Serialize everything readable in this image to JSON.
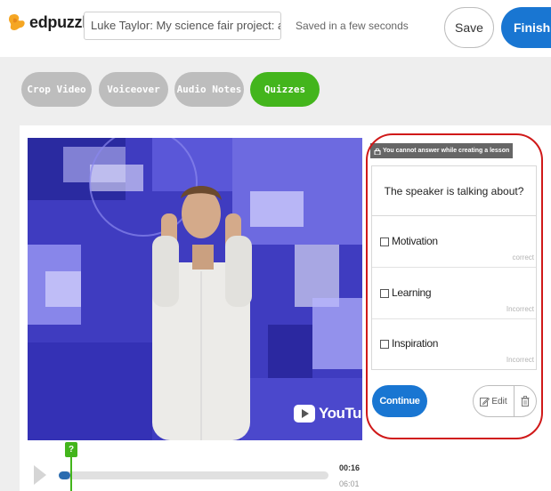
{
  "brand": {
    "name": "edpuzzle"
  },
  "header": {
    "title_value": "Luke Taylor: My science fair project: a robot that…",
    "saved_status": "Saved in a few seconds",
    "save_label": "Save",
    "finish_label": "Finish"
  },
  "tabs": [
    {
      "label": "Crop Video",
      "active": false
    },
    {
      "label": "Voiceover",
      "active": false
    },
    {
      "label": "Audio Notes",
      "active": false
    },
    {
      "label": "Quizzes",
      "active": true
    }
  ],
  "video": {
    "provider_logo": "YouTube"
  },
  "player": {
    "current_time": "00:16",
    "total_time": "06:01",
    "marker_label": "?",
    "progress_fraction": 0.044
  },
  "quiz": {
    "locked_notice": "You cannot answer while creating a lesson",
    "question": "The speaker is talking about?",
    "answers": [
      {
        "label": "Motivation",
        "status": "correct"
      },
      {
        "label": "Learning",
        "status": "Incorrect"
      },
      {
        "label": "Inspiration",
        "status": "Incorrect"
      }
    ],
    "continue_label": "Continue",
    "edit_label": "Edit"
  },
  "colors": {
    "accent_blue": "#1976d2",
    "accent_green": "#43b51c",
    "highlight_red": "#d01919"
  },
  "icons": [
    "puzzle-logo-icon",
    "lock-icon",
    "play-icon",
    "edit-icon",
    "trash-icon",
    "youtube-play-icon"
  ]
}
